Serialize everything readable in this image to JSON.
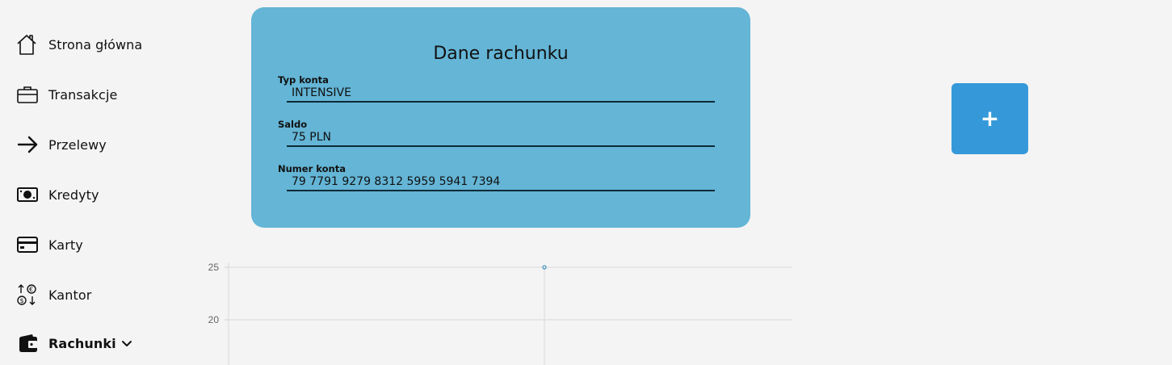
{
  "sidebar": {
    "items": [
      {
        "label": "Strona główna",
        "icon": "home-icon"
      },
      {
        "label": "Transakcje",
        "icon": "briefcase-icon"
      },
      {
        "label": "Przelewy",
        "icon": "arrow-right-icon"
      },
      {
        "label": "Kredyty",
        "icon": "banknote-icon"
      },
      {
        "label": "Karty",
        "icon": "credit-card-icon"
      },
      {
        "label": "Kantor",
        "icon": "currency-exchange-icon"
      },
      {
        "label": "Rachunki",
        "icon": "wallet-icon",
        "active": true,
        "expandable": true
      }
    ]
  },
  "account_card": {
    "title": "Dane rachunku",
    "fields": [
      {
        "label": "Typ konta",
        "value": "INTENSIVE"
      },
      {
        "label": "Saldo",
        "value": "75 PLN"
      },
      {
        "label": "Numer konta",
        "value": "79 7791 9279 8312 5959 5941 7394"
      }
    ],
    "background_color": "#64b5d6"
  },
  "add_button": {
    "label": "+",
    "color": "#3599d9"
  },
  "chart_data": {
    "type": "line",
    "y_ticks": [
      25,
      20
    ],
    "points": [
      {
        "y": 25
      }
    ],
    "grid": true,
    "point_color": "#3a8fb7"
  }
}
